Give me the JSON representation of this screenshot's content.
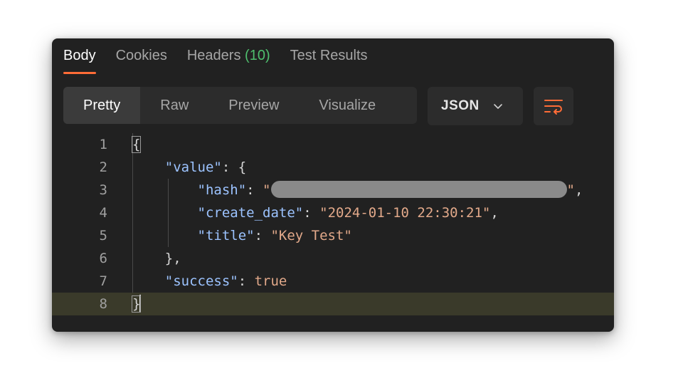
{
  "tabs": {
    "body": "Body",
    "cookies": "Cookies",
    "headers": "Headers",
    "headers_count": "(10)",
    "test_results": "Test Results"
  },
  "view": {
    "pretty": "Pretty",
    "raw": "Raw",
    "preview": "Preview",
    "visualize": "Visualize"
  },
  "format": {
    "selected": "JSON"
  },
  "icons": {
    "format_dropdown": "chevron-down-icon",
    "wrap": "wrap-lines-icon"
  },
  "colors": {
    "accent": "#ff6c37",
    "panel_bg": "#212121",
    "header_count": "#4fbf6e",
    "json_key": "#9cc3ff",
    "json_string": "#e2a98a"
  },
  "code": {
    "line_numbers": [
      "1",
      "2",
      "3",
      "4",
      "5",
      "6",
      "7",
      "8"
    ],
    "open_brace": "{",
    "close_brace": "}",
    "value_key": "\"value\"",
    "hash_key": "\"hash\"",
    "create_date_key": "\"create_date\"",
    "create_date_value": "\"2024-01-10 22:30:21\"",
    "title_key": "\"title\"",
    "title_value": "\"Key Test\"",
    "success_key": "\"success\"",
    "success_value": "true"
  }
}
